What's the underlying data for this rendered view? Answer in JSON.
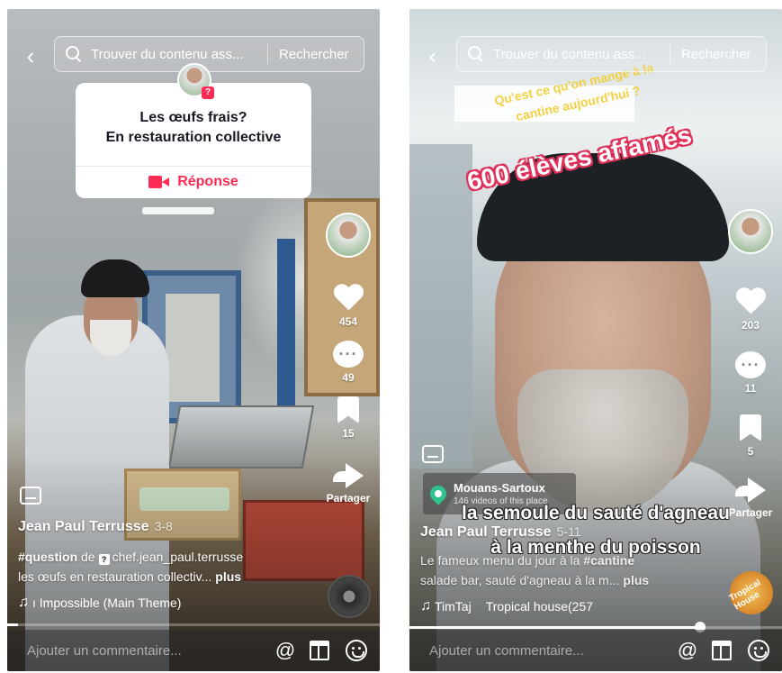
{
  "left": {
    "search": {
      "placeholder": "Trouver du contenu ass...",
      "button": "Rechercher"
    },
    "question": {
      "title_line1": "Les œufs frais?",
      "title_line2": "En restauration collective",
      "reply": "Réponse"
    },
    "rail": {
      "likes": "454",
      "comments": "49",
      "saves": "15",
      "share": "Partager"
    },
    "author": "Jean Paul Terrusse",
    "date": "3-8",
    "desc_tag": "#question",
    "desc_de": "de",
    "desc_mention": "chef.jean_paul.terrusse",
    "desc_text": "les œufs en restauration collectiv...",
    "more": "plus",
    "music": "ı Impossible (Main Theme)",
    "comment_placeholder": "Ajouter un commentaire...",
    "progress": 0.03
  },
  "right": {
    "search": {
      "placeholder": "Trouver du contenu ass...",
      "button": "Rechercher"
    },
    "overlay_question": "Qu'est ce qu'on mange à la cantine aujourd'hui ?",
    "overlay_big": "600 élèves affamés",
    "rail": {
      "likes": "203",
      "comments": "11",
      "saves": "5",
      "share": "Partager"
    },
    "location": {
      "name": "Mouans-Sartoux",
      "sub": "146 videos of this place"
    },
    "subtitle_line1": "la semoule du sauté d'agneau",
    "subtitle_line2": "à la menthe du poisson",
    "author": "Jean Paul Terrusse",
    "date": "5-11",
    "desc_text": "Le fameux menu du jour à la",
    "desc_tag": "#cantine",
    "desc_line2": "salade bar, sauté d'agneau à la m...",
    "more": "plus",
    "music_artist": "TimTaj",
    "music_title": "Tropical house(257",
    "disc_label": "Tropical House",
    "comment_placeholder": "Ajouter un commentaire...",
    "progress": 0.78
  },
  "icons": {
    "back": "‹",
    "mention": "@",
    "note": "♫"
  }
}
